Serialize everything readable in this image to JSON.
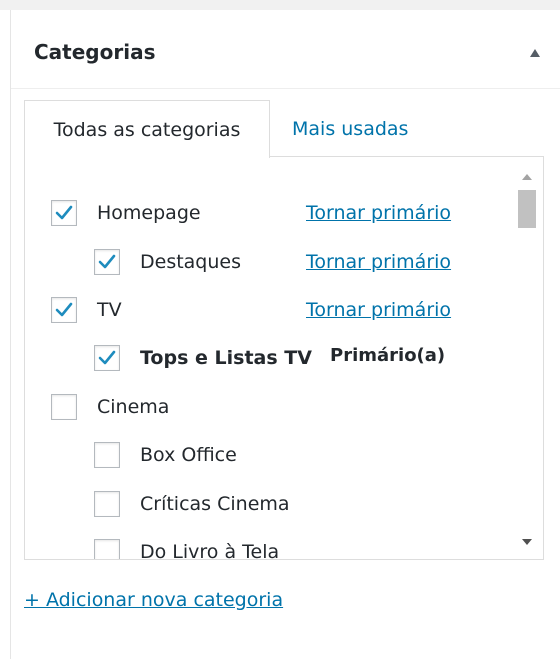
{
  "header": {
    "title": "Categorias"
  },
  "tabs": {
    "all": "Todas as categorias",
    "popular": "Mais usadas"
  },
  "categories": [
    {
      "label": "Homepage",
      "checked": true,
      "level": 0,
      "action": "Tornar primário"
    },
    {
      "label": "Destaques",
      "checked": true,
      "level": 1,
      "action": "Tornar primário"
    },
    {
      "label": "TV",
      "checked": true,
      "level": 0,
      "action": "Tornar primário"
    },
    {
      "label": "Tops e Listas TV",
      "checked": true,
      "level": 1,
      "badge": "Primário(a)"
    },
    {
      "label": "Cinema",
      "checked": false,
      "level": 0
    },
    {
      "label": "Box Office",
      "checked": false,
      "level": 1
    },
    {
      "label": "Críticas Cinema",
      "checked": false,
      "level": 1
    },
    {
      "label": "Do Livro à Tela",
      "checked": false,
      "level": 1
    }
  ],
  "add_link": "+ Adicionar nova categoria",
  "colors": {
    "accent": "#0073aa",
    "check": "#1e8cbe",
    "border": "#dddddd"
  }
}
